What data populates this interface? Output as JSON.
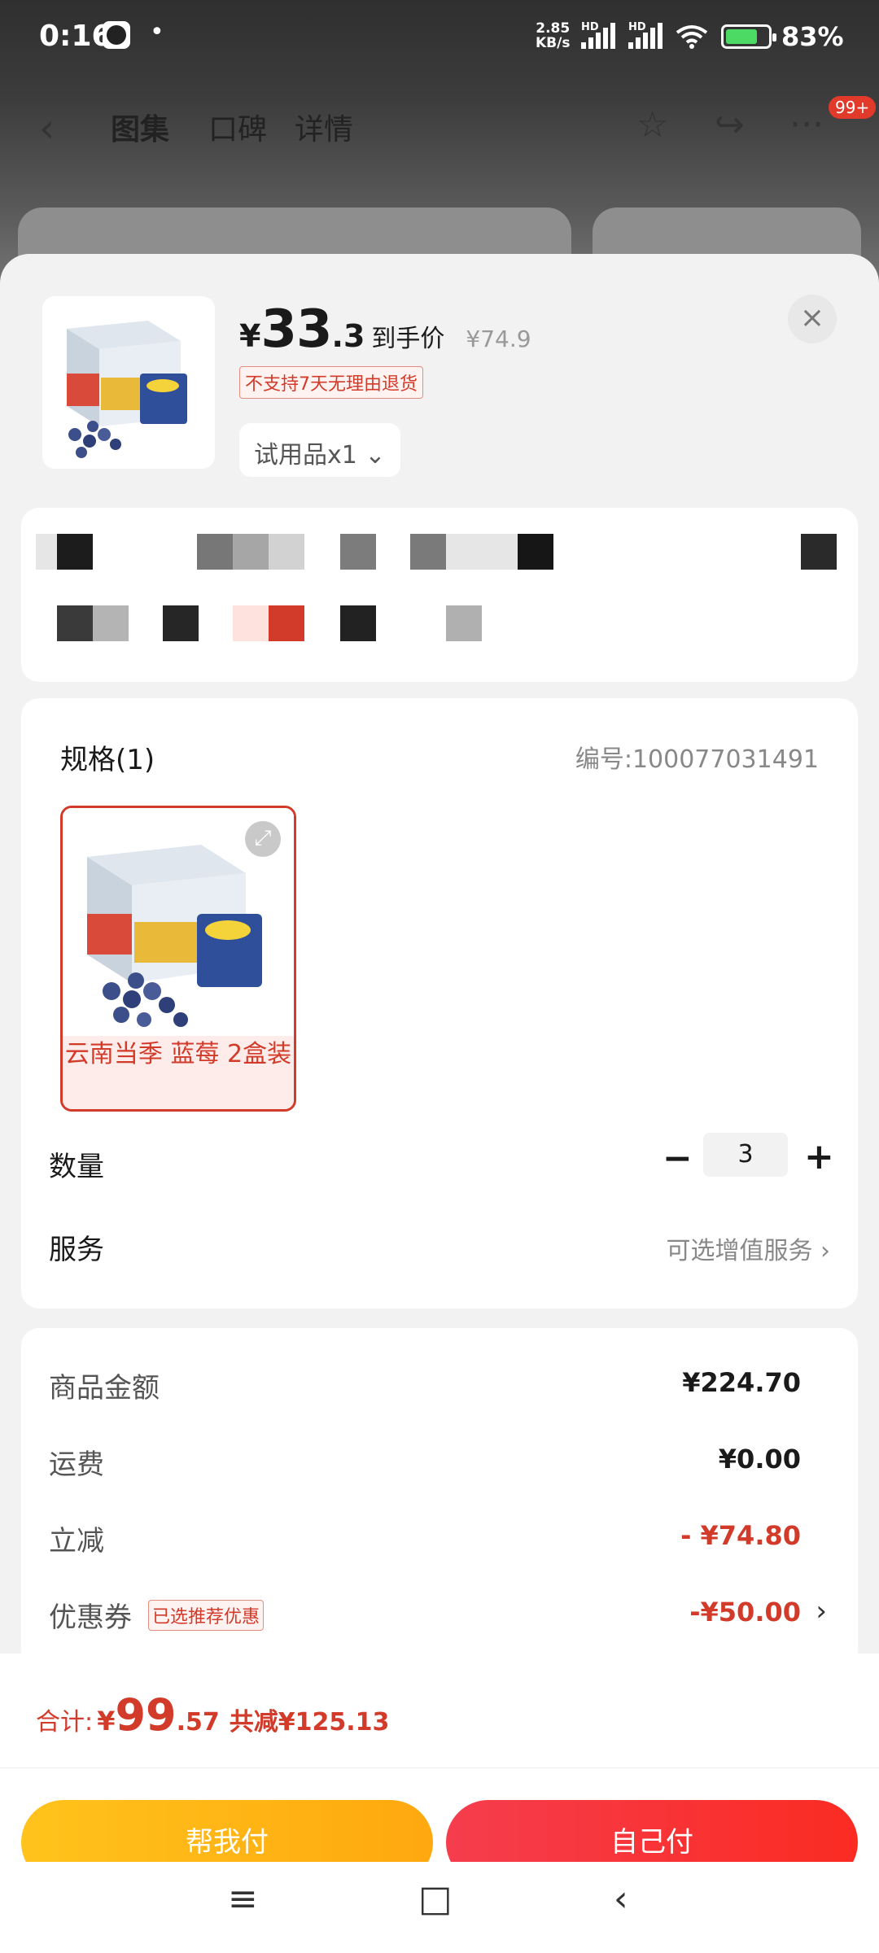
{
  "status_bar": {
    "time": "0:16",
    "dot": "•",
    "net_speed_top": "2.85",
    "net_speed_bottom": "KB/s",
    "hd1": "HD",
    "hd2": "HD",
    "battery": "83%"
  },
  "top_nav": {
    "back": "‹",
    "tabs": [
      "图集",
      "口碑",
      "详情"
    ],
    "badge": "99+",
    "star": "☆",
    "share": "↪",
    "more": "···"
  },
  "product": {
    "price_currency": "¥",
    "price_int": "33",
    "price_dec": ".3",
    "price_label": "到手价",
    "original_price": "¥74.9",
    "return_tag": "不支持7天无理由退货",
    "sku_select": "试用品x1 ⌄",
    "close": "×"
  },
  "spec": {
    "title": "规格(1)",
    "number": "编号:100077031491",
    "item_caption": "云南当季 蓝莓 2盒装",
    "expand": "⤢"
  },
  "quantity": {
    "label": "数量",
    "minus": "−",
    "value": "3",
    "plus": "+"
  },
  "service": {
    "label": "服务",
    "value": "可选增值服务 ›"
  },
  "price_detail": {
    "rows": [
      {
        "label": "商品金额",
        "value": "¥224.70"
      },
      {
        "label": "运费",
        "value": "¥0.00"
      },
      {
        "label": "立减",
        "value": "- ¥74.80"
      },
      {
        "label": "优惠券",
        "value": "-¥50.00",
        "tag": "已选推荐优惠",
        "chevron": "›"
      }
    ]
  },
  "footer": {
    "total_label": "合计:",
    "total_currency": "¥",
    "total_int": "99",
    "total_dec": ".57",
    "total_save": "共减¥125.13",
    "help_pay": "帮我付",
    "self_pay": "自己付"
  },
  "nav_bar": {
    "menu": "≡",
    "home": "□",
    "back": "‹"
  },
  "colors": {
    "accent_red": "#d23a2a",
    "help_pay_yellow": "#ffb414",
    "self_pay_red": "#f83434"
  }
}
